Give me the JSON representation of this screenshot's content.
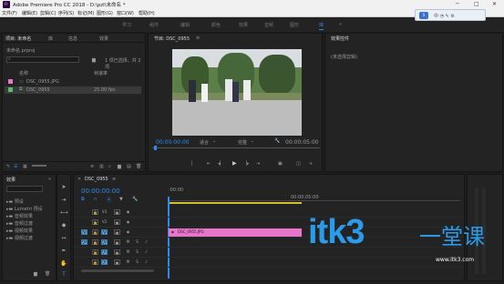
{
  "app": {
    "title": "Adobe Premiere Pro CC 2018 - D:\\pzl\\未命名 *"
  },
  "menu": [
    "文件(F)",
    "编辑(E)",
    "剪辑(C)",
    "序列(S)",
    "标记(M)",
    "图形(G)",
    "窗口(W)",
    "帮助(H)"
  ],
  "workspaces": [
    "学习",
    "组件",
    "编辑",
    "颜色",
    "效果",
    "音频",
    "图形",
    "库"
  ],
  "project": {
    "tabs": [
      "项目: 未命名",
      "库",
      "信息",
      "效果"
    ],
    "filename": "未命名.prproj",
    "search_placeholder": "",
    "item_count": "1 项已选择，共 2 项",
    "col_name": "名称",
    "col_fps": "帧速率",
    "items": [
      {
        "name": "DSC_0955.JPG",
        "fps": "",
        "color": "#e676c9"
      },
      {
        "name": "DSC_0955",
        "fps": "25.00 fps",
        "color": "#5fb86b"
      }
    ]
  },
  "source": {
    "tab": "节目: DSC_0955",
    "timecode": "00:00:00:00",
    "fit": "适合",
    "quality": "完整",
    "duration": "00:00:05:00"
  },
  "effect_controls": {
    "tab": "效果控件",
    "message": "(未选择剪辑)"
  },
  "timeline": {
    "tab": "DSC_0955",
    "timecode": "00:00:00:00",
    "ruler_start": ":00:00",
    "ruler_mark": "00:00:05:00",
    "tracks": [
      {
        "name": "V3",
        "kind": "video"
      },
      {
        "name": "V2",
        "kind": "video"
      },
      {
        "name": "V1",
        "kind": "video"
      },
      {
        "name": "A1",
        "kind": "audio"
      },
      {
        "name": "A2",
        "kind": "audio"
      },
      {
        "name": "A3",
        "kind": "audio"
      }
    ],
    "clip": {
      "name": "DSC_0955.JPG",
      "color": "#e676c9"
    }
  },
  "effects_panel": {
    "tab": "效果",
    "items": [
      "预设",
      "Lumetri 预设",
      "音频效果",
      "音频过渡",
      "视频效果",
      "视频过渡"
    ]
  },
  "watermark": {
    "text": "itk3",
    "cjk": "一堂课",
    "url": "www.itk3.com"
  },
  "colors": {
    "accent": "#2d8ceb",
    "clip": "#e676c9",
    "audio_green": "#5fb86b"
  }
}
